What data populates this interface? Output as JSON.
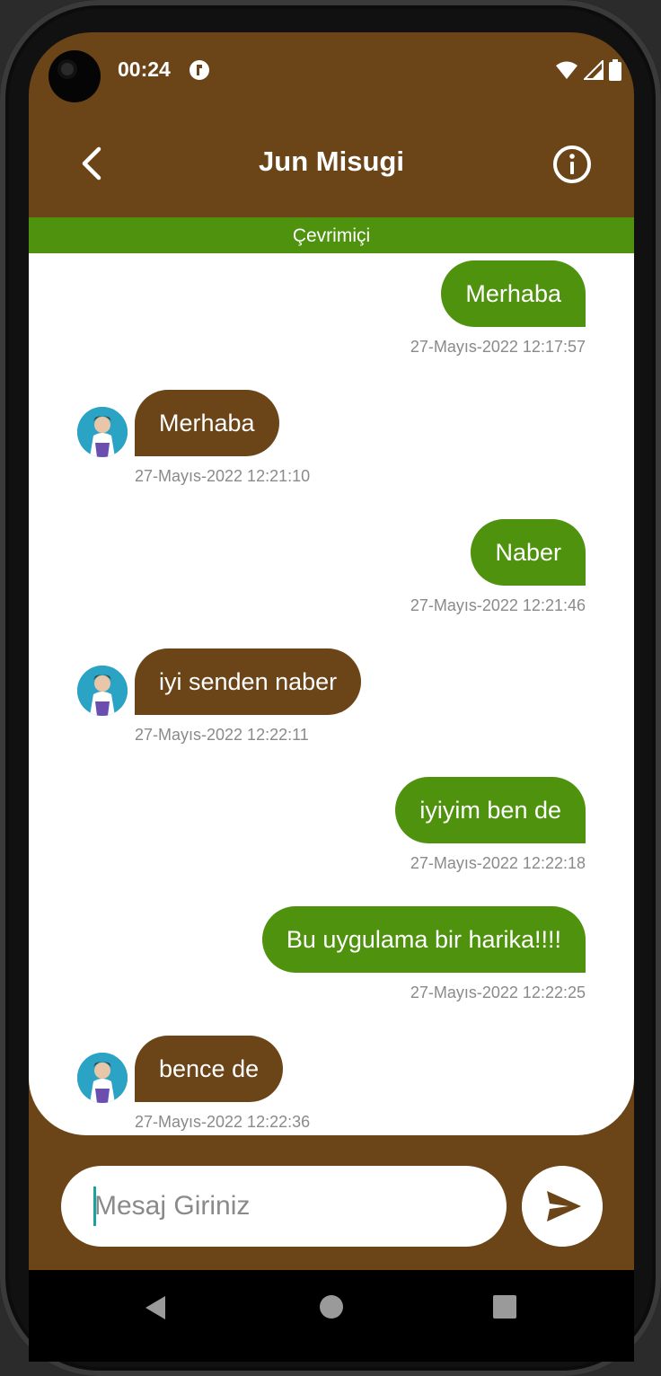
{
  "status_bar": {
    "time": "00:24"
  },
  "header": {
    "title": "Jun Misugi",
    "presence": "Çevrimiçi"
  },
  "messages": [
    {
      "direction": "sent",
      "text": "Merhaba",
      "timestamp": "27-Mayıs-2022 12:17:57"
    },
    {
      "direction": "received",
      "text": "Merhaba",
      "timestamp": "27-Mayıs-2022 12:21:10"
    },
    {
      "direction": "sent",
      "text": "Naber",
      "timestamp": "27-Mayıs-2022 12:21:46"
    },
    {
      "direction": "received",
      "text": "iyi senden naber",
      "timestamp": "27-Mayıs-2022 12:22:11"
    },
    {
      "direction": "sent",
      "text": "iyiyim ben de",
      "timestamp": "27-Mayıs-2022 12:22:18"
    },
    {
      "direction": "sent",
      "text": "Bu uygulama bir harika!!!!",
      "timestamp": "27-Mayıs-2022 12:22:25"
    },
    {
      "direction": "received",
      "text": "bence de",
      "timestamp": "27-Mayıs-2022 12:22:36"
    }
  ],
  "composer": {
    "placeholder": "Mesaj Giriniz",
    "value": ""
  },
  "colors": {
    "brown": "#6b4417",
    "green": "#4e920e",
    "background": "#ffffff"
  },
  "icons": {
    "back": "chevron-left-icon",
    "info": "info-icon",
    "send": "send-icon",
    "nav_back": "triangle-back-icon",
    "nav_home": "circle-home-icon",
    "nav_recents": "square-recents-icon"
  }
}
